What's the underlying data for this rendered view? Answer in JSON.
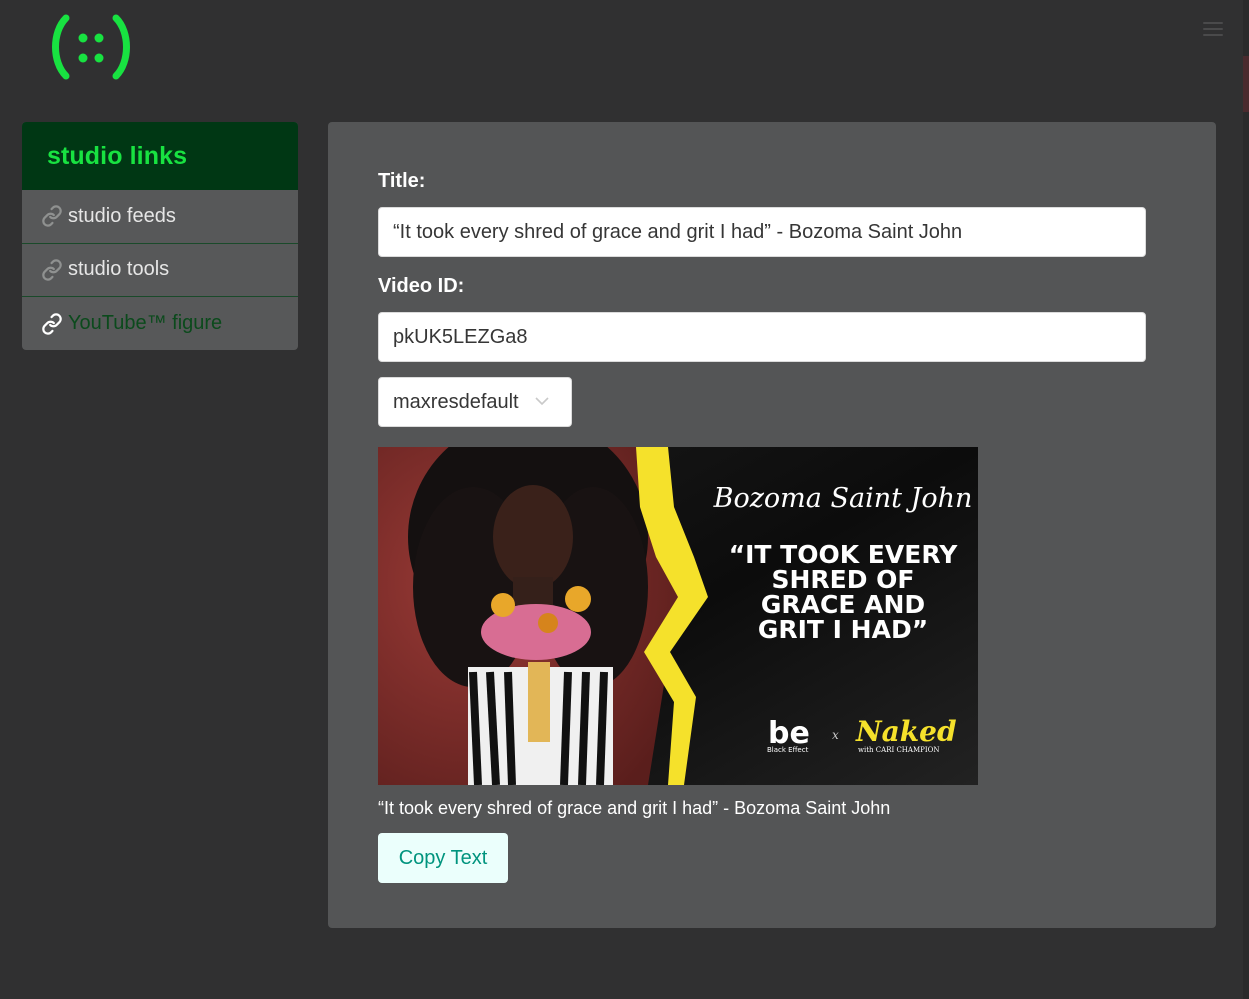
{
  "app": {
    "logo_text": "(::)"
  },
  "colors": {
    "accent": "#18e241",
    "sidebar_header_bg": "#003714",
    "active_link": "#0b4a1c",
    "button_text": "#00947e"
  },
  "sidebar": {
    "title": "studio links",
    "items": [
      {
        "label": "studio feeds",
        "icon": "link-icon",
        "active": false
      },
      {
        "label": "studio tools",
        "icon": "link-icon",
        "active": false
      },
      {
        "label": "YouTube™ figure",
        "icon": "link-icon",
        "active": true
      }
    ]
  },
  "form": {
    "title_label": "Title:",
    "title_value": "“It took every shred of grace and grit I had” - Bozoma Saint John",
    "video_id_label": "Video ID:",
    "video_id_value": "pkUK5LEZGa8",
    "resolution_selected": "maxresdefault"
  },
  "thumbnail": {
    "name_script": "Bozoma Saint John",
    "quote_lines": [
      "“IT TOOK EVERY",
      "SHRED OF",
      "GRACE AND",
      "GRIT I HAD”"
    ],
    "brand_left": "be",
    "brand_left_sub": "Black Effect",
    "brand_x": "x",
    "brand_right": "Naked",
    "brand_right_sub": "with CARI CHAMPION"
  },
  "caption": "“It took every shred of grace and grit I had” - Bozoma Saint John",
  "copy_button_label": "Copy Text"
}
